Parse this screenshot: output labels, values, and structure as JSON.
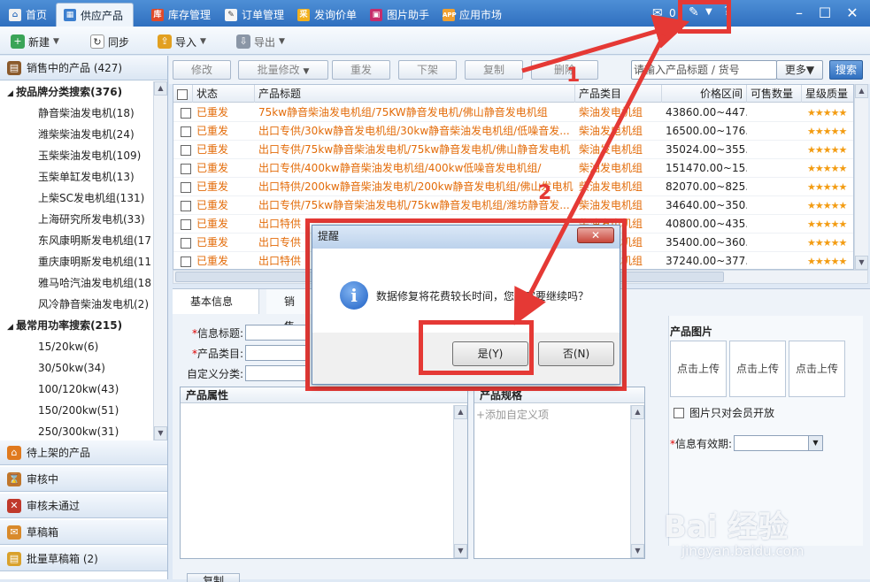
{
  "tabs": [
    {
      "label": "首页",
      "icon": "home-icon"
    },
    {
      "label": "供应产品",
      "icon": "supply-icon"
    },
    {
      "label": "库存管理",
      "icon": "stock-icon"
    },
    {
      "label": "订单管理",
      "icon": "order-icon"
    },
    {
      "label": "发询价单",
      "icon": "inquiry-icon"
    },
    {
      "label": "图片助手",
      "icon": "picture-icon"
    },
    {
      "label": "应用市场",
      "icon": "app-icon"
    }
  ],
  "header": {
    "mail_count": "0"
  },
  "toolbar": {
    "new": "新建",
    "sync": "同步",
    "import": "导入",
    "export": "导出"
  },
  "sidebar": {
    "selling_title": "销售中的产品 (427)",
    "brand_group": "按品牌分类搜索(376)",
    "brand_items": [
      "静音柴油发电机(18)",
      "潍柴柴油发电机(24)",
      "玉柴柴油发电机(109)",
      "玉柴单缸发电机(13)",
      "上柴SC发电机组(131)",
      "上海研究所发电机(33)",
      "东风康明斯发电机组(17)",
      "重庆康明斯发电机组(11)",
      "雅马哈汽油发电机组(18)",
      "风冷静音柴油发电机(2)"
    ],
    "power_group": "最常用功率搜索(215)",
    "power_items": [
      "15/20kw(6)",
      "30/50kw(34)",
      "100/120kw(43)",
      "150/200kw(51)",
      "250/300kw(31)"
    ],
    "bottom": [
      "待上架的产品",
      "审核中",
      "审核未通过",
      "草稿箱",
      "批量草稿箱 (2)"
    ]
  },
  "actions": {
    "modify": "修改",
    "batch_modify": "批量修改",
    "republish": "重发",
    "offline": "下架",
    "copy": "复制",
    "delete": "删除",
    "search_placeholder": "请输入产品标题 / 货号",
    "more": "更多▼",
    "search": "搜索"
  },
  "grid": {
    "headers": [
      "状态",
      "产品标题",
      "产品类目",
      "价格区间",
      "可售数量",
      "星级质量"
    ],
    "rows": [
      {
        "status": "已重发",
        "title": "75kw静音柴油发电机组/75KW静音发电机/佛山静音发电机组",
        "category": "柴油发电机组",
        "price": "43860.00~447..."
      },
      {
        "status": "已重发",
        "title": "出口专供/30kw静音发电机组/30kw静音柴油发电机组/低噪音发...",
        "category": "柴油发电机组",
        "price": "16500.00~176..."
      },
      {
        "status": "已重发",
        "title": "出口专供/75kw静音柴油发电机/75kw静音发电机/佛山静音发电机",
        "category": "柴油发电机组",
        "price": "35024.00~355..."
      },
      {
        "status": "已重发",
        "title": "出口专供/400kw静音柴油发电机组/400kw低噪音发电机组/",
        "category": "柴油发电机组",
        "price": "151470.00~15..."
      },
      {
        "status": "已重发",
        "title": "出口特供/200kw静音柴油发电机/200kw静音发电机组/佛山发电机",
        "category": "柴油发电机组",
        "price": "82070.00~825..."
      },
      {
        "status": "已重发",
        "title": "出口专供/75kw静音柴油发电机/75kw静音发电机组/潍坊静音发...",
        "category": "柴油发电机组",
        "price": "34640.00~350..."
      },
      {
        "status": "已重发",
        "title": "出口特供",
        "category": "柴油发电机组",
        "price": "40800.00~435..."
      },
      {
        "status": "已重发",
        "title": "出口专供",
        "category": "柴油发电机组",
        "price": "35400.00~360..."
      },
      {
        "status": "已重发",
        "title": "出口特供",
        "category": "柴油发电机组",
        "price": "37240.00~377..."
      }
    ]
  },
  "detail": {
    "tabs": [
      "基本信息",
      "销售"
    ],
    "info_title": "信息标题:",
    "category": "产品类目:",
    "custom": "自定义分类:",
    "attrs": "产品属性",
    "specs": "产品规格",
    "add_custom": "+添加自定义项",
    "images": "产品图片",
    "upload": "点击上传",
    "member_only": "图片只对会员开放",
    "validity": "信息有效期:",
    "bottom_copy": "复制"
  },
  "dialog": {
    "title": "提醒",
    "message": "数据修复将花费较长时间，您确定要继续吗？",
    "yes": "是(Y)",
    "no": "否(N)"
  },
  "annotations": {
    "one": "1",
    "two": "2"
  },
  "watermark": {
    "brand": "Bai 经验",
    "url": "jingyan.baidu.com"
  }
}
